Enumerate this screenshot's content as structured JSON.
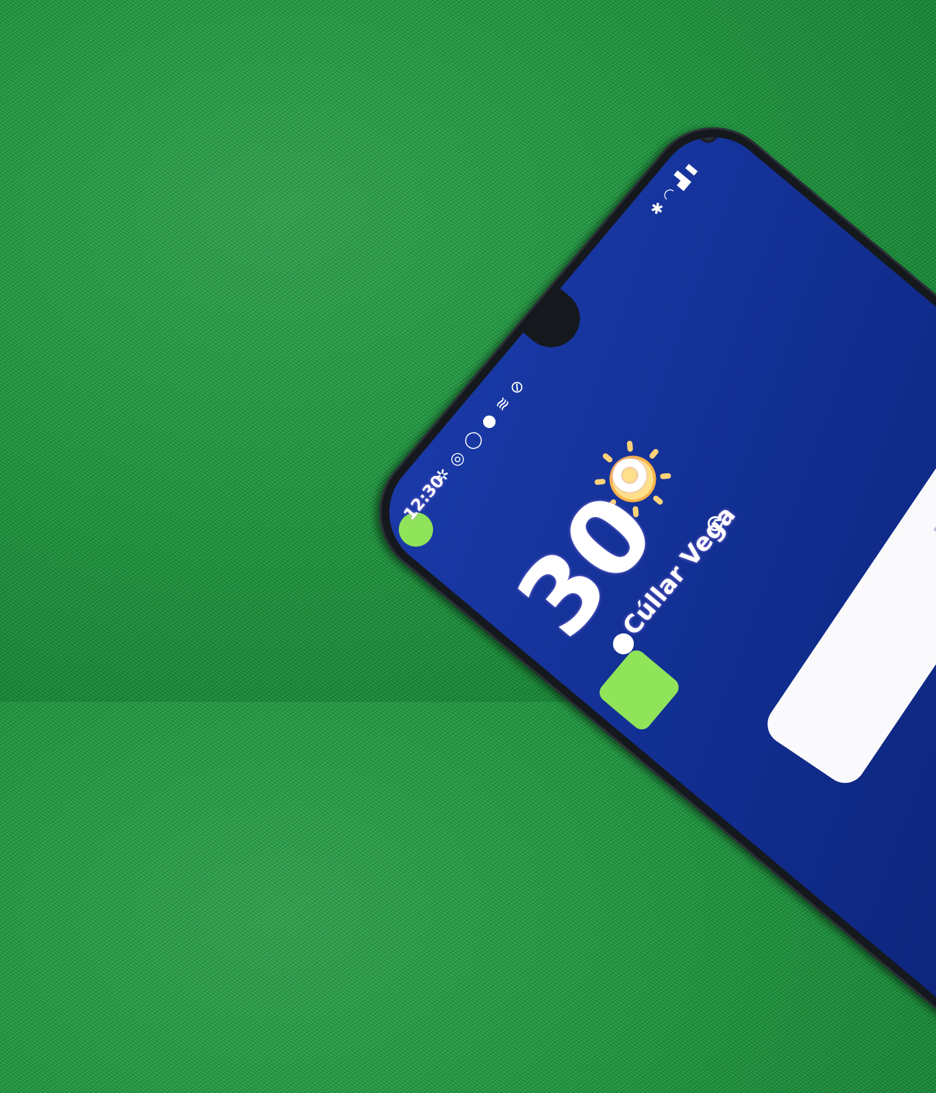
{
  "status_bar": {
    "time": "12:30",
    "notification_icons": [
      "slack-icon",
      "instagram-icon",
      "whatsapp-icon",
      "location-icon",
      "nfc-icon",
      "no-sim-icon"
    ],
    "system_icons": [
      "bluetooth-icon",
      "wifi-icon",
      "signal-icon",
      "battery-icon"
    ]
  },
  "weather": {
    "temperature": "30°",
    "location": "Cúllar Vega",
    "condition_icon": "sun-icon"
  },
  "search_bar": {
    "hint": "Di \"O"
  },
  "colors": {
    "background": "#1f9a40",
    "screen": "#102c8c",
    "sun": "#ffe08a"
  }
}
